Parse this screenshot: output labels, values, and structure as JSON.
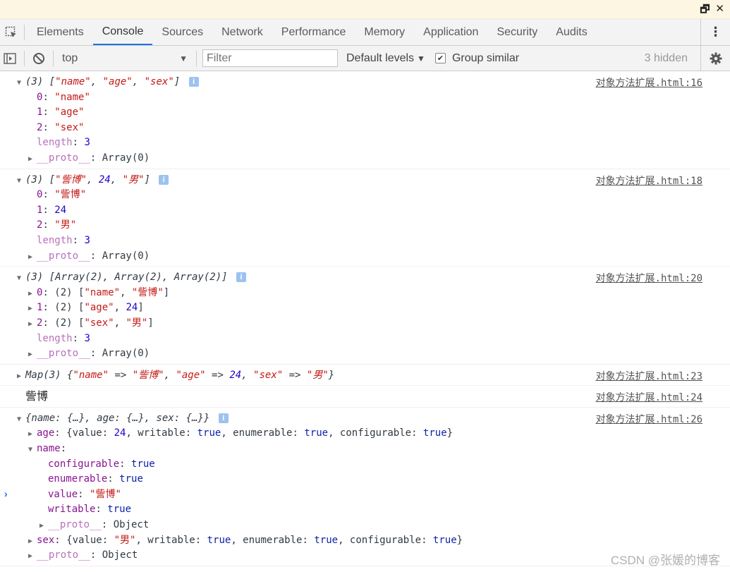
{
  "window": {
    "restore_label": "🗗",
    "close_label": "✕"
  },
  "tabs": [
    "Elements",
    "Console",
    "Sources",
    "Network",
    "Performance",
    "Memory",
    "Application",
    "Security",
    "Audits"
  ],
  "toolbar": {
    "context": "top",
    "filter_placeholder": "Filter",
    "levels_label": "Default levels",
    "group_similar_label": "Group similar",
    "hidden_count": "3 hidden"
  },
  "messages": [
    {
      "source": "对象方法扩展.html:16",
      "lines": [
        {
          "indent": 0,
          "tri": "▼",
          "html": "<span class=\"it\">(3) [<span class=\"str\">\"name\"</span>, <span class=\"str\">\"age\"</span>, <span class=\"str\">\"sex\"</span>]</span> <span class=\"info\">i</span>"
        },
        {
          "indent": 1,
          "tri": "",
          "html": "<span class=\"key\">0</span>: <span class=\"str\">\"name\"</span>"
        },
        {
          "indent": 1,
          "tri": "",
          "html": "<span class=\"key\">1</span>: <span class=\"str\">\"age\"</span>"
        },
        {
          "indent": 1,
          "tri": "",
          "html": "<span class=\"key\">2</span>: <span class=\"str\">\"sex\"</span>"
        },
        {
          "indent": 1,
          "tri": "",
          "html": "<span class=\"keyp\">length</span>: <span class=\"num\">3</span>"
        },
        {
          "indent": 1,
          "tri": "▶",
          "html": "<span class=\"keyp\">__proto__</span>: Array(0)"
        }
      ]
    },
    {
      "source": "对象方法扩展.html:18",
      "lines": [
        {
          "indent": 0,
          "tri": "▼",
          "html": "<span class=\"it\">(3) [<span class=\"str\">\"訾博\"</span>, <span class=\"num\">24</span>, <span class=\"str\">\"男\"</span>]</span> <span class=\"info\">i</span>"
        },
        {
          "indent": 1,
          "tri": "",
          "html": "<span class=\"key\">0</span>: <span class=\"str\">\"訾博\"</span>"
        },
        {
          "indent": 1,
          "tri": "",
          "html": "<span class=\"key\">1</span>: <span class=\"num\">24</span>"
        },
        {
          "indent": 1,
          "tri": "",
          "html": "<span class=\"key\">2</span>: <span class=\"str\">\"男\"</span>"
        },
        {
          "indent": 1,
          "tri": "",
          "html": "<span class=\"keyp\">length</span>: <span class=\"num\">3</span>"
        },
        {
          "indent": 1,
          "tri": "▶",
          "html": "<span class=\"keyp\">__proto__</span>: Array(0)"
        }
      ]
    },
    {
      "source": "对象方法扩展.html:20",
      "lines": [
        {
          "indent": 0,
          "tri": "▼",
          "html": "<span class=\"it\">(3) [Array(2), Array(2), Array(2)]</span> <span class=\"info\">i</span>"
        },
        {
          "indent": 1,
          "tri": "▶",
          "html": "<span class=\"key\">0</span>: (2) [<span class=\"str\">\"name\"</span>, <span class=\"str\">\"訾博\"</span>]"
        },
        {
          "indent": 1,
          "tri": "▶",
          "html": "<span class=\"key\">1</span>: (2) [<span class=\"str\">\"age\"</span>, <span class=\"num\">24</span>]"
        },
        {
          "indent": 1,
          "tri": "▶",
          "html": "<span class=\"key\">2</span>: (2) [<span class=\"str\">\"sex\"</span>, <span class=\"str\">\"男\"</span>]"
        },
        {
          "indent": 1,
          "tri": "",
          "html": "<span class=\"keyp\">length</span>: <span class=\"num\">3</span>"
        },
        {
          "indent": 1,
          "tri": "▶",
          "html": "<span class=\"keyp\">__proto__</span>: Array(0)"
        }
      ]
    },
    {
      "source": "对象方法扩展.html:23",
      "lines": [
        {
          "indent": 0,
          "tri": "▶",
          "html": "<span class=\"it\">Map(3) {<span class=\"str\">\"name\"</span> =&gt; <span class=\"str\">\"訾博\"</span>, <span class=\"str\">\"age\"</span> =&gt; <span class=\"num\">24</span>, <span class=\"str\">\"sex\"</span> =&gt; <span class=\"str\">\"男\"</span>}</span>"
        }
      ]
    },
    {
      "source": "对象方法扩展.html:24",
      "lines": [
        {
          "indent": 0,
          "tri": "",
          "html": "<span class=\"plain\">訾博</span>"
        }
      ]
    },
    {
      "source": "对象方法扩展.html:26",
      "lines": [
        {
          "indent": 0,
          "tri": "▼",
          "html": "<span class=\"it\">{name: {…}, age: {…}, sex: {…}}</span> <span class=\"info\">i</span>"
        },
        {
          "indent": 1,
          "tri": "▶",
          "html": "<span class=\"key\">age</span>: {value: <span class=\"num\">24</span>, writable: <span class=\"bool\">true</span>, enumerable: <span class=\"bool\">true</span>, configurable: <span class=\"bool\">true</span>}"
        },
        {
          "indent": 1,
          "tri": "▼",
          "html": "<span class=\"key\">name</span>:"
        },
        {
          "indent": 2,
          "tri": "",
          "html": "<span class=\"key\">configurable</span>: <span class=\"bool\">true</span>"
        },
        {
          "indent": 2,
          "tri": "",
          "html": "<span class=\"key\">enumerable</span>: <span class=\"bool\">true</span>"
        },
        {
          "indent": 2,
          "tri": "",
          "html": "<span class=\"key\">value</span>: <span class=\"str\">\"訾博\"</span>"
        },
        {
          "indent": 2,
          "tri": "",
          "html": "<span class=\"key\">writable</span>: <span class=\"bool\">true</span>"
        },
        {
          "indent": 2,
          "tri": "▶",
          "html": "<span class=\"keyp\">__proto__</span>: Object"
        },
        {
          "indent": 1,
          "tri": "▶",
          "html": "<span class=\"key\">sex</span>: {value: <span class=\"str\">\"男\"</span>, writable: <span class=\"bool\">true</span>, enumerable: <span class=\"bool\">true</span>, configurable: <span class=\"bool\">true</span>}"
        },
        {
          "indent": 1,
          "tri": "▶",
          "html": "<span class=\"keyp\">__proto__</span>: Object"
        }
      ]
    }
  ],
  "prompt_symbol": "›",
  "watermark": "CSDN @张媛的博客"
}
